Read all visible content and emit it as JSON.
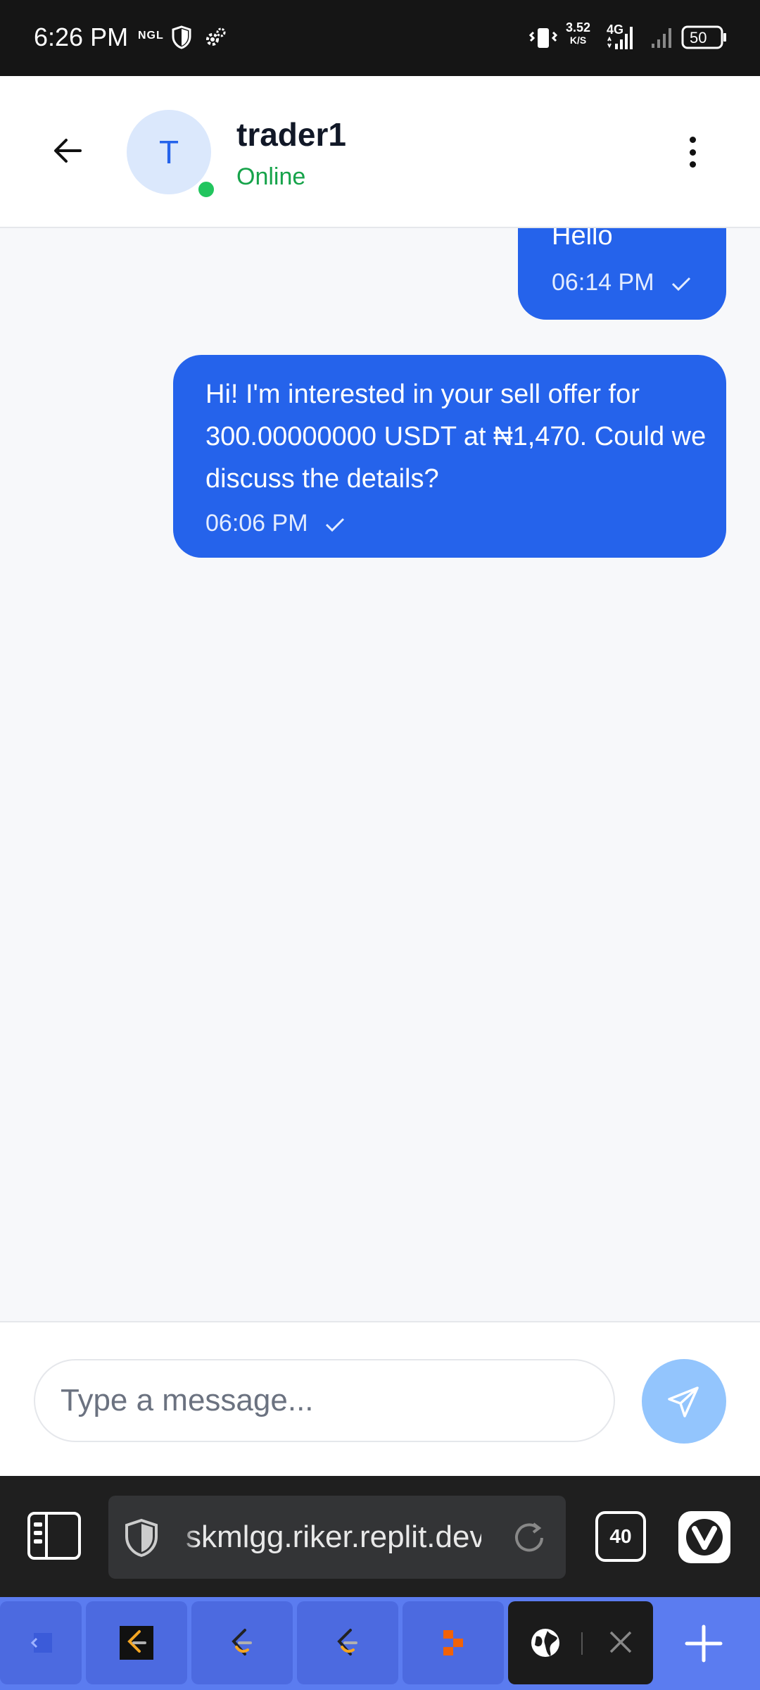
{
  "status_bar": {
    "time": "6:26 PM",
    "ngl_label": "NGL",
    "net_speed_value": "3.52",
    "net_speed_unit": "K/S",
    "network_type": "4G",
    "battery_level": "50"
  },
  "chat_header": {
    "avatar_initial": "T",
    "contact_name": "trader1",
    "contact_status": "Online"
  },
  "messages": [
    {
      "text": "Hello",
      "time": "06:14 PM"
    },
    {
      "text": "Hi! I'm interested in your sell offer for 300.00000000 USDT at ₦1,470. Could we discuss the details?",
      "time": "06:06 PM"
    }
  ],
  "composer": {
    "placeholder": "Type a message..."
  },
  "browser": {
    "url": "skmlgg.riker.replit.dev",
    "tab_count": "40"
  },
  "colors": {
    "accent": "#2563eb",
    "online": "#22c55e",
    "send_button": "#93c5fd",
    "tab_strip": "#5b7cf0"
  },
  "icons": {
    "back": "arrow-left-icon",
    "more": "more-vertical-icon",
    "send": "send-icon",
    "check": "check-icon"
  }
}
